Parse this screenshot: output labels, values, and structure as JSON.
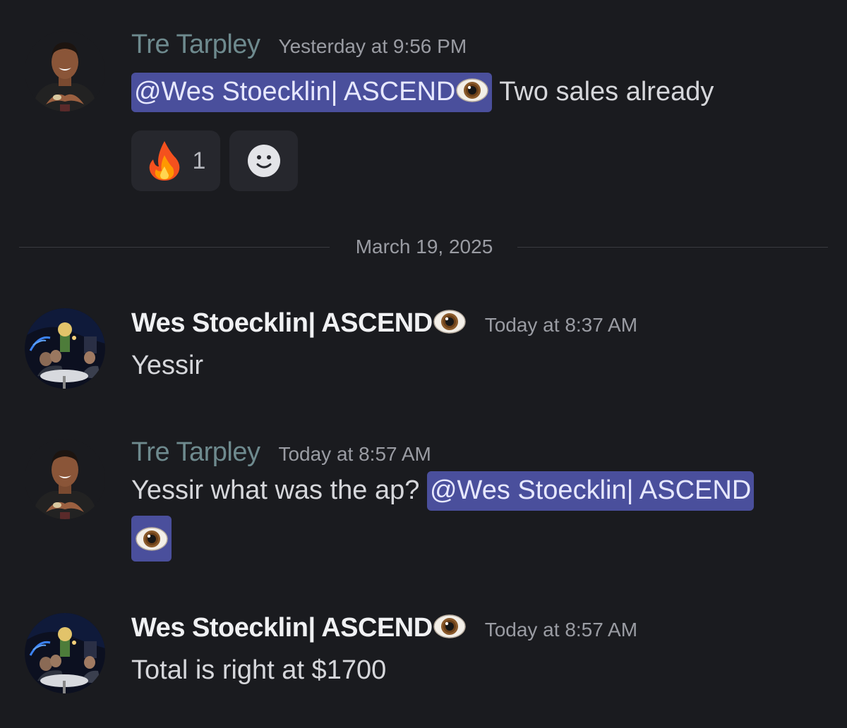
{
  "messages": [
    {
      "author": "Tre Tarpley",
      "timestamp": "Yesterday at 9:56 PM",
      "mention": "@Wes Stoecklin| ASCEND",
      "text": " Two sales already",
      "reactions": [
        {
          "emoji": "fire-emoji",
          "count": "1"
        },
        {
          "emoji": "add-reaction-icon"
        }
      ]
    },
    {
      "author": "Wes Stoecklin| ASCEND",
      "timestamp": "Today at 8:37 AM",
      "text": "Yessir"
    },
    {
      "author": "Tre Tarpley",
      "timestamp": "Today at 8:57 AM",
      "text": "Yessir what was the ap? ",
      "mention": "@Wes Stoecklin| ASCEND"
    },
    {
      "author": "Wes Stoecklin| ASCEND",
      "timestamp": "Today at 8:57 AM",
      "text": "Total is right at $1700"
    }
  ],
  "date_divider": "March 19, 2025",
  "colors": {
    "background": "#1a1b1f",
    "mention_bg": "#4a4f9c",
    "tre_name": "#6e8a8e",
    "wes_name": "#f0f1f3",
    "timestamp": "#9a9ca3",
    "reaction_bg": "#26272d"
  }
}
